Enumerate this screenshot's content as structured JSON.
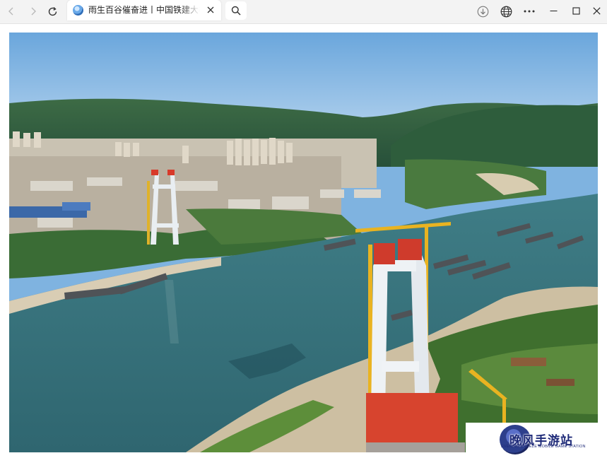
{
  "browser": {
    "tab_title": "雨生百谷催奋进丨中国铁建大桥",
    "icons": {
      "back": "arrow-left-icon",
      "forward": "arrow-right-icon",
      "refresh": "refresh-icon",
      "close_tab": "close-icon",
      "search": "search-icon",
      "download": "download-icon",
      "globe": "globe-icon",
      "more": "more-icon",
      "minimize": "minimize-icon",
      "maximize": "maximize-icon",
      "close_window": "close-window-icon"
    }
  },
  "content": {
    "image": "aerial photo of a cable-stayed bridge tower under construction beside a river and city",
    "watermark": {
      "title": "晚风手游站",
      "subtitle": "EVENING BREEZE MOBILE GAME STATION"
    }
  }
}
